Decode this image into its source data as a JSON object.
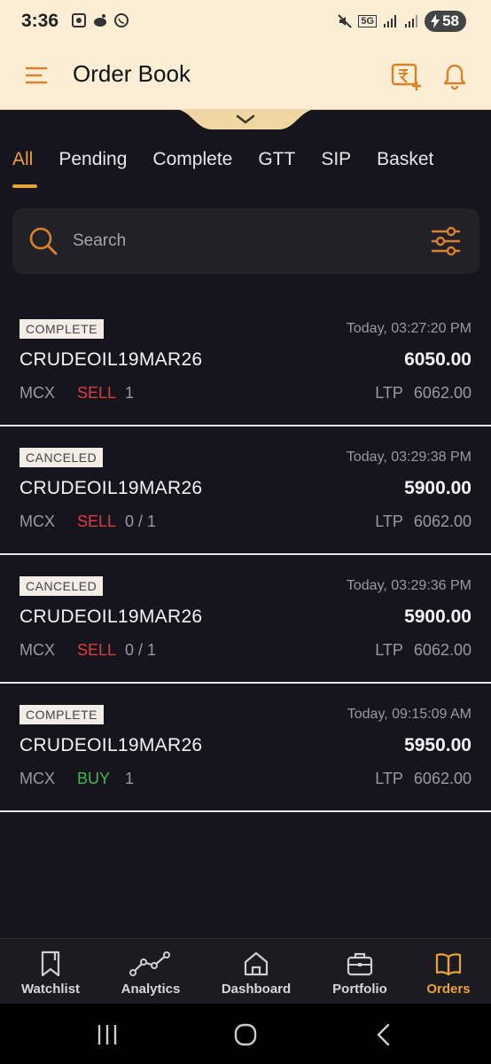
{
  "status_bar": {
    "time": "3:36",
    "battery": "58",
    "network": "5G"
  },
  "header": {
    "title": "Order Book"
  },
  "tabs": [
    {
      "label": "All",
      "active": true
    },
    {
      "label": "Pending",
      "active": false
    },
    {
      "label": "Complete",
      "active": false
    },
    {
      "label": "GTT",
      "active": false
    },
    {
      "label": "SIP",
      "active": false
    },
    {
      "label": "Basket",
      "active": false
    }
  ],
  "search": {
    "placeholder": "Search",
    "value": ""
  },
  "orders": [
    {
      "status": "COMPLETE",
      "time": "Today, 03:27:20 PM",
      "symbol": "CRUDEOIL19MAR26",
      "price": "6050.00",
      "exchange": "MCX",
      "side": "SELL",
      "qty": "1",
      "ltp_label": "LTP",
      "ltp": "6062.00"
    },
    {
      "status": "CANCELED",
      "time": "Today, 03:29:38 PM",
      "symbol": "CRUDEOIL19MAR26",
      "price": "5900.00",
      "exchange": "MCX",
      "side": "SELL",
      "qty": "0 / 1",
      "ltp_label": "LTP",
      "ltp": "6062.00"
    },
    {
      "status": "CANCELED",
      "time": "Today, 03:29:36 PM",
      "symbol": "CRUDEOIL19MAR26",
      "price": "5900.00",
      "exchange": "MCX",
      "side": "SELL",
      "qty": "0 / 1",
      "ltp_label": "LTP",
      "ltp": "6062.00"
    },
    {
      "status": "COMPLETE",
      "time": "Today, 09:15:09 AM",
      "symbol": "CRUDEOIL19MAR26",
      "price": "5950.00",
      "exchange": "MCX",
      "side": "BUY",
      "qty": "1",
      "ltp_label": "LTP",
      "ltp": "6062.00"
    }
  ],
  "bottom_nav": [
    {
      "label": "Watchlist",
      "icon": "bookmark-icon",
      "active": false
    },
    {
      "label": "Analytics",
      "icon": "analytics-icon",
      "active": false
    },
    {
      "label": "Dashboard",
      "icon": "home-icon",
      "active": false
    },
    {
      "label": "Portfolio",
      "icon": "briefcase-icon",
      "active": false
    },
    {
      "label": "Orders",
      "icon": "book-icon",
      "active": true
    }
  ],
  "colors": {
    "accent": "#e8a23b",
    "header_bg": "#fbeed5",
    "background": "#16141c",
    "sell": "#e53a3a",
    "buy": "#3dbb4b"
  }
}
